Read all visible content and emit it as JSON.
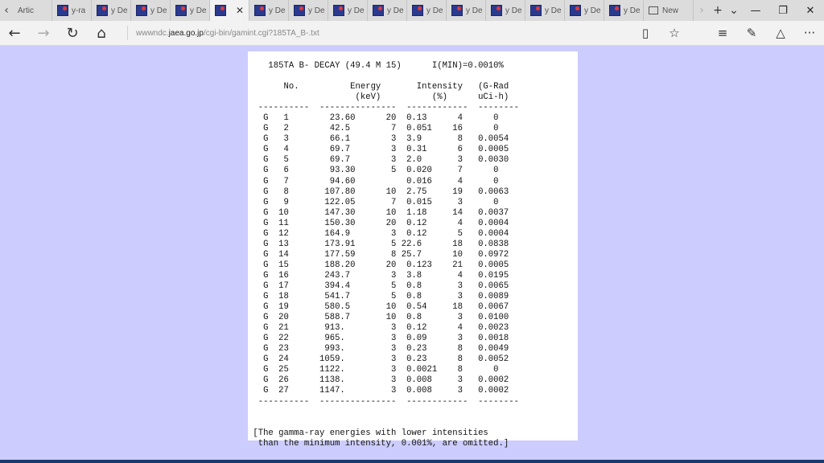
{
  "tabs": [
    {
      "title": "Artic",
      "kind": "plain"
    },
    {
      "title": "y-ra",
      "kind": "fav"
    },
    {
      "title": "y De",
      "kind": "fav"
    },
    {
      "title": "y De",
      "kind": "fav"
    },
    {
      "title": "y De",
      "kind": "fav"
    },
    {
      "title": "",
      "kind": "active"
    },
    {
      "title": "y De",
      "kind": "fav"
    },
    {
      "title": "y De",
      "kind": "fav"
    },
    {
      "title": "y De",
      "kind": "fav"
    },
    {
      "title": "y De",
      "kind": "fav"
    },
    {
      "title": "y De",
      "kind": "fav"
    },
    {
      "title": "y De",
      "kind": "fav"
    },
    {
      "title": "y De",
      "kind": "fav"
    },
    {
      "title": "y De",
      "kind": "fav"
    },
    {
      "title": "y De",
      "kind": "fav"
    },
    {
      "title": "y De",
      "kind": "fav"
    },
    {
      "title": "New",
      "kind": "new"
    }
  ],
  "address": {
    "prefix": "wwwndc.",
    "domain": "jaea.go.jp",
    "path": "/cgi-bin/gamint.cgi?185TA_B-.txt"
  },
  "document": {
    "header_line": "    185TA B- DECAY (49.4 M 15)      I(MIN)=0.0010%",
    "col_line1": "       No.          Energy       Intensity   (G-Rad",
    "col_line2": "                     (keV)          (%)      uCi-h)",
    "separator": "  ----------  ---------------  ------------  --------",
    "rows": [
      "   G   1        23.60      20  0.13      4      0",
      "   G   2        42.5        7  0.051    16      0",
      "   G   3        66.1        3  3.9       8   0.0054",
      "   G   4        69.7        3  0.31      6   0.0005",
      "   G   5        69.7        3  2.0       3   0.0030",
      "   G   6        93.30       5  0.020     7      0",
      "   G   7        94.60          0.016     4      0",
      "   G   8       107.80      10  2.75     19   0.0063",
      "   G   9       122.05       7  0.015     3      0",
      "   G  10       147.30      10  1.18     14   0.0037",
      "   G  11       150.30      20  0.12      4   0.0004",
      "   G  12       164.9        3  0.12      5   0.0004",
      "   G  13       173.91       5 22.6      18   0.0838",
      "   G  14       177.59       8 25.7      10   0.0972",
      "   G  15       188.20      20  0.123    21   0.0005",
      "   G  16       243.7        3  3.8       4   0.0195",
      "   G  17       394.4        5  0.8       3   0.0065",
      "   G  18       541.7        5  0.8       3   0.0089",
      "   G  19       580.5       10  0.54     18   0.0067",
      "   G  20       588.7       10  0.8       3   0.0100",
      "   G  21       913.         3  0.12      4   0.0023",
      "   G  22       965.         3  0.09      3   0.0018",
      "   G  23       993.         3  0.23      8   0.0049",
      "   G  24      1059.         3  0.23      8   0.0052",
      "   G  25      1122.         3  0.0021    8      0",
      "   G  26      1138.         3  0.008     3   0.0002",
      "   G  27      1147.         3  0.008     3   0.0002"
    ],
    "footer_line1": " [The gamma-ray energies with lower intensities",
    "footer_line2": "  than the minimum intensity, 0.001%, are omitted.]"
  },
  "colors": {
    "page_background": "#ccccff",
    "document_background": "#ffffff"
  }
}
